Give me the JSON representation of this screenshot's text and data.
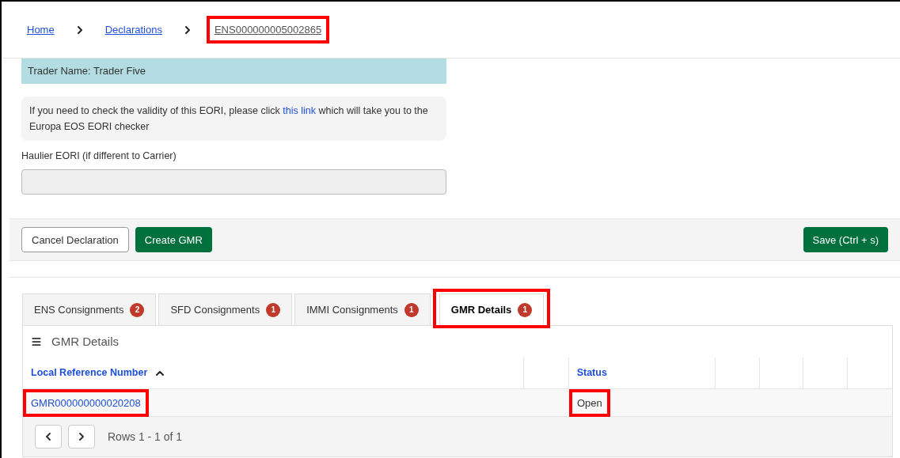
{
  "breadcrumb": [
    {
      "label": "Home",
      "current": false,
      "highlighted": false
    },
    {
      "label": "Declarations",
      "current": false,
      "highlighted": false
    },
    {
      "label": "ENS000000005002865",
      "current": true,
      "highlighted": true
    }
  ],
  "trader_banner": "Trader Name: Trader Five",
  "eori_notice": {
    "before": "If you need to check the validity of this EORI, please click",
    "link": "this link",
    "after": "which will take you to the Europa EOS EORI checker"
  },
  "haulier_field": {
    "label": "Haulier EORI (if different to Carrier)",
    "disabled": true
  },
  "actions": [
    {
      "label": "Cancel Declaration",
      "kind": "secondary"
    },
    {
      "label": "Create GMR",
      "kind": "primary"
    }
  ],
  "save_button": "Save (Ctrl + s)",
  "tabs": [
    {
      "label": "ENS Consignments",
      "count": "2",
      "selected": false,
      "highlighted": false
    },
    {
      "label": "SFD Consignments",
      "count": "1",
      "selected": false,
      "highlighted": false
    },
    {
      "label": "IMMI Consignments",
      "count": "1",
      "selected": false,
      "highlighted": false
    },
    {
      "label": "GMR Details",
      "count": "1",
      "selected": true,
      "highlighted": true
    }
  ],
  "panel_title": "GMR Details",
  "table": {
    "columns": [
      {
        "label": "Local Reference Number",
        "sorted": true
      },
      {},
      {
        "label": "Status",
        "sorted": false
      },
      {},
      {},
      {},
      {}
    ],
    "rows": [
      {
        "lrn": "GMR000000000020208",
        "lrn_highlighted": true,
        "status": "Open",
        "status_highlighted": true
      }
    ]
  },
  "pagination": "Rows 1 - 1 of 1"
}
